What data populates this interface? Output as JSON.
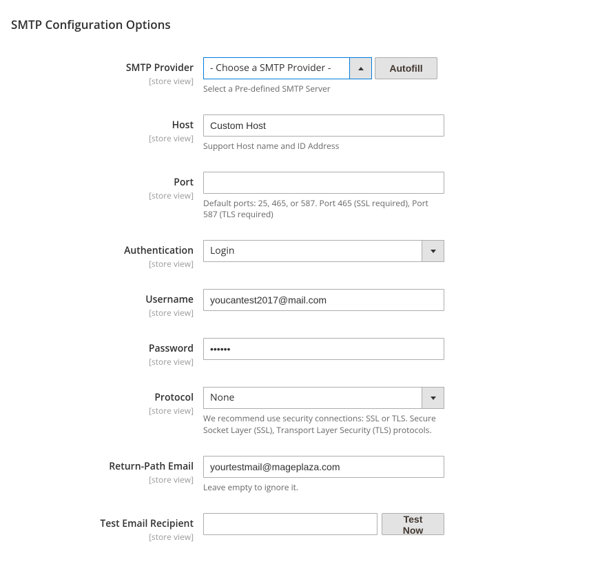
{
  "section_title": "SMTP Configuration Options",
  "scope_text": "[store view]",
  "fields": {
    "smtp_provider": {
      "label": "SMTP Provider",
      "value": "- Choose a SMTP Provider -",
      "help": "Select a Pre-defined SMTP Server",
      "autofill_btn": "Autofill"
    },
    "host": {
      "label": "Host",
      "value": "Custom Host",
      "help": "Support Host name and ID Address"
    },
    "port": {
      "label": "Port",
      "value": "",
      "help": "Default ports: 25, 465, or 587. Port 465 (SSL required), Port 587 (TLS required)"
    },
    "authentication": {
      "label": "Authentication",
      "value": "Login"
    },
    "username": {
      "label": "Username",
      "value": "youcantest2017@mail.com"
    },
    "password": {
      "label": "Password",
      "value": "••••••"
    },
    "protocol": {
      "label": "Protocol",
      "value": "None",
      "help": "We recommend use security connections: SSL or TLS. Secure Socket Layer (SSL), Transport Layer Security (TLS) protocols."
    },
    "return_path": {
      "label": "Return-Path Email",
      "value": "yourtestmail@mageplaza.com",
      "help": "Leave empty to ignore it."
    },
    "test_recipient": {
      "label": "Test Email Recipient",
      "value": "",
      "test_btn": "Test Now"
    }
  }
}
